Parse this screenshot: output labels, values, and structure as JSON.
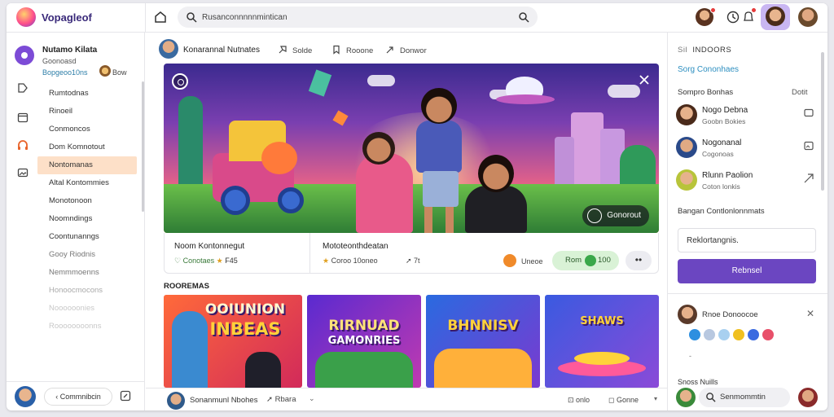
{
  "app": {
    "title": "Vopagleof"
  },
  "search": {
    "text": "Rusanconnnnnmintican"
  },
  "account": {
    "name": "Nutamo Kilata",
    "sub": "Goonoasd",
    "sub2": "Bopgeoo10ns",
    "mini_label": "Bow"
  },
  "nav": {
    "items": [
      "Rumtodnas",
      "Rinoeil",
      "Conmoncos",
      "Dom Komnotout",
      "Nontomanas",
      "Altal Kontommies",
      "Monotonoon",
      "Noomndings",
      "Coontunanngs",
      "Gooy Riodnis",
      "Nemmmoenns",
      "Honoocmocons",
      "Noooooonies",
      "Roooooooonns"
    ]
  },
  "left_footer": {
    "pill": "‹ Commnibcin"
  },
  "main": {
    "header": {
      "title": "Konarannal Nutnates",
      "actions": [
        "Solde",
        "Rooone",
        "Donwor"
      ]
    },
    "hero": {
      "badge": "Gonorout"
    },
    "card1": {
      "title": "Noom Kontonnegut",
      "meta": "Conotaes",
      "meta2": "F45"
    },
    "card2": {
      "title": "Mototeonthdeatan",
      "meta": "Coroo 10oneo",
      "share": "7t"
    },
    "card_actions": {
      "heart_label": "Uneoe",
      "pill_label": "Rom",
      "pill_value": "100",
      "more": "••"
    },
    "section_label": "ROOREMAS",
    "thumbnails": [
      {
        "line1": "OOIUNION",
        "line2": "INBEAS"
      },
      {
        "line1": "RIRNUAD",
        "line2": "GAMONRIES"
      },
      {
        "line1": "BHNNISV",
        "line2": ""
      },
      {
        "line1": "SHAWS",
        "line2": ""
      }
    ],
    "footer": {
      "title": "Sonanmunl Nbohes",
      "share": "Rbara",
      "r1": "onlo",
      "r2": "Gonne"
    }
  },
  "right": {
    "header": "INDOORS",
    "link": "Sorg Cononhaes",
    "subheader": "Sompro Bonhas",
    "subheader_right": "Dotit",
    "friends": [
      {
        "name": "Nogo Debna",
        "sub": "Goobn Bokies"
      },
      {
        "name": "Nogonanal",
        "sub": "Cogonoas"
      },
      {
        "name": "Rlunn Paolion",
        "sub": "Coton lonkis"
      }
    ],
    "line": "Bangan Contlonlonnmats",
    "input": "Reklortangnis.",
    "button": "Rebnsel",
    "note": "Rnoe Donoocoe",
    "footer_text": "Snoss Nuills",
    "footer_search": "Senmommtin"
  }
}
